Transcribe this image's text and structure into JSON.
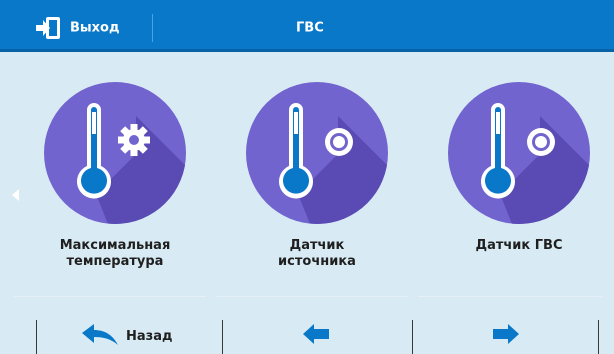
{
  "header": {
    "exit_label": "Выход",
    "title": "ГВС",
    "exit_icon": "exit-door-icon"
  },
  "tiles": [
    {
      "label": "Максимальная\nтемпература",
      "icon": "thermometer-gear-icon"
    },
    {
      "label": "Датчик\nисточника",
      "icon": "thermometer-sensor-icon"
    },
    {
      "label": "Датчик ГВС",
      "icon": "thermometer-sensor-icon"
    }
  ],
  "footer": {
    "back_label": "Назад",
    "back_icon": "back-arrow-icon",
    "prev_icon": "arrow-left-icon",
    "next_icon": "arrow-right-icon"
  },
  "colors": {
    "header_bg": "#0a78c8",
    "background": "#d8ebf5",
    "circle_fill": "#7264cf",
    "icon_blue": "#0a78c8"
  }
}
